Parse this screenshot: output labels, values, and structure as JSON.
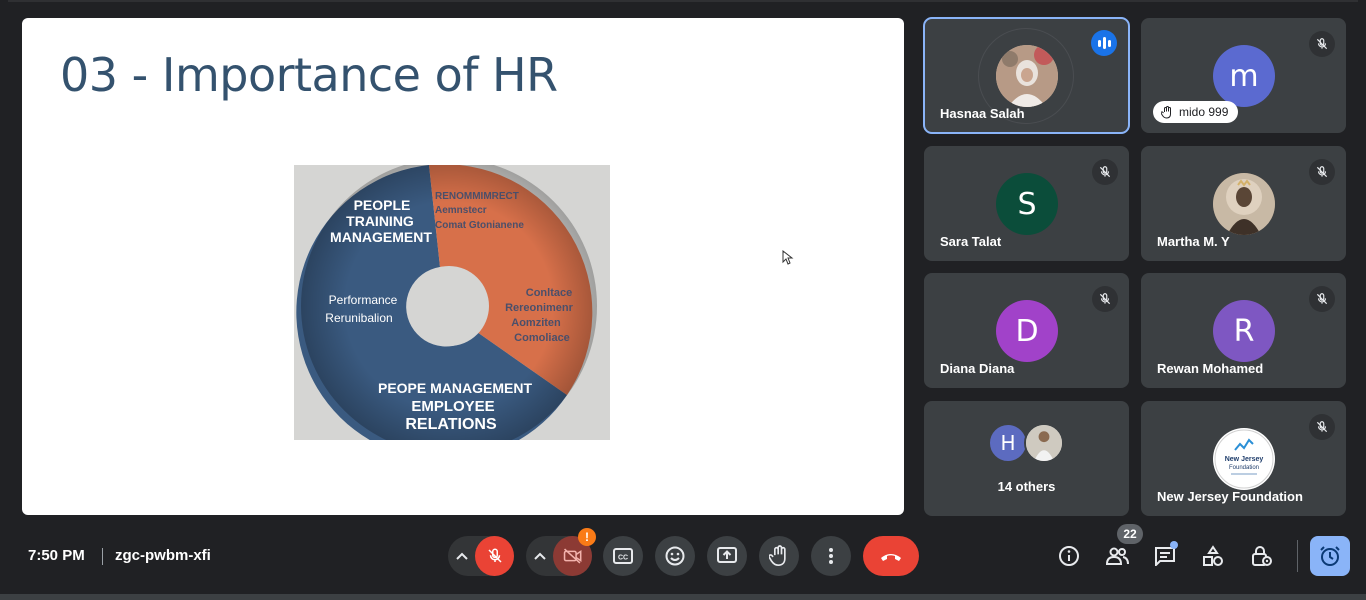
{
  "slide": {
    "title": "03 - Importance of HR",
    "figure_labels": {
      "blue_top": [
        "PEOPLE",
        "TRAINING",
        "MANAGEMENT"
      ],
      "orange_top": [
        "RENOMMIMRECT",
        "Aemnstecr",
        "Comat Gtonianene"
      ],
      "blue_left": [
        "Performance",
        "Rerunibalion"
      ],
      "orange_right": [
        "Conltace",
        "Rereonimenr",
        "Aomziten",
        "Comoliace"
      ],
      "blue_bottom": [
        "PEOPE MANAGEMENT",
        "EMPLOYEE",
        "RELATIONS"
      ]
    }
  },
  "participants": [
    {
      "name": "Hasnaa Salah",
      "avatar": "photo",
      "speaking": true,
      "active": true
    },
    {
      "name": "mido 999",
      "initial": "m",
      "avatar_color": "#5b6ad0",
      "muted": true,
      "hand_raised": true
    },
    {
      "name": "Sara Talat",
      "initial": "S",
      "avatar_color": "#0b4d3a",
      "muted": true
    },
    {
      "name": "Martha M. Y",
      "avatar": "photo",
      "muted": true
    },
    {
      "name": "Diana Diana",
      "initial": "D",
      "avatar_color": "#a142c9",
      "muted": true
    },
    {
      "name": "Rewan Mohamed",
      "initial": "R",
      "avatar_color": "#7e57c2",
      "muted": true
    },
    {
      "name": "New Jersey Foundation",
      "avatar": "logo",
      "logo_text": [
        "New Jersey",
        "Foundation"
      ],
      "muted": true
    }
  ],
  "others": {
    "label": "14 others",
    "initial": "H",
    "avatar_color": "#5c6bc0"
  },
  "bottom_bar": {
    "time": "7:50 PM",
    "meeting_code": "zgc-pwbm-xfi",
    "camera_warning": "!",
    "people_count": "22"
  },
  "icons": {
    "mic": "mic-off-icon",
    "camera": "camera-off-icon",
    "captions": "captions-icon",
    "emoji": "emoji-icon",
    "present": "present-icon",
    "hand": "raise-hand-icon",
    "more": "more-vert-icon",
    "end": "call-end-icon",
    "info": "info-icon",
    "people": "people-icon",
    "chat": "chat-icon",
    "activities": "activities-icon",
    "host": "host-controls-icon",
    "timer": "alarm-icon"
  },
  "colors": {
    "accent": "#8ab4f8",
    "danger": "#ea4335",
    "warning": "#fa7b17",
    "tile_bg": "#3c4043"
  }
}
